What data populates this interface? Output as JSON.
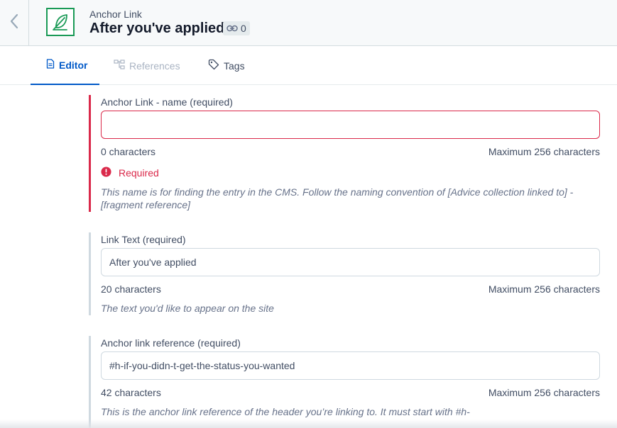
{
  "header": {
    "content_type": "Anchor Link",
    "title": "After you've applied",
    "reference_count": "0"
  },
  "tabs": [
    {
      "label": "Editor",
      "active": true
    },
    {
      "label": "References",
      "active": false
    },
    {
      "label": "Tags",
      "active": false
    }
  ],
  "fields": [
    {
      "label": "Anchor Link - name (required)",
      "value": "",
      "count": "0 characters",
      "max": "Maximum 256 characters",
      "error": "Required",
      "help": "This name is for finding the entry in the CMS. Follow the naming convention of [Advice collection linked to] - [fragment reference]"
    },
    {
      "label": "Link Text (required)",
      "value": "After you've applied",
      "count": "20 characters",
      "max": "Maximum 256 characters",
      "help": "The text you'd like to appear on the site"
    },
    {
      "label": "Anchor link reference (required)",
      "value": "#h-if-you-didn-t-get-the-status-you-wanted",
      "count": "42 characters",
      "max": "Maximum 256 characters",
      "help": "This is the anchor link reference of the header you’re linking to. It must start with #h-"
    }
  ],
  "colors": {
    "accent": "#0059c8",
    "error": "#da294a",
    "entry_icon": "#1a9a56"
  },
  "icons": {
    "back": "chevron-left-icon",
    "entry": "feather-icon",
    "references_badge": "link-icon",
    "tab_editor": "document-icon",
    "tab_references": "references-icon",
    "tab_tags": "tag-icon",
    "error": "error-circle-icon"
  }
}
